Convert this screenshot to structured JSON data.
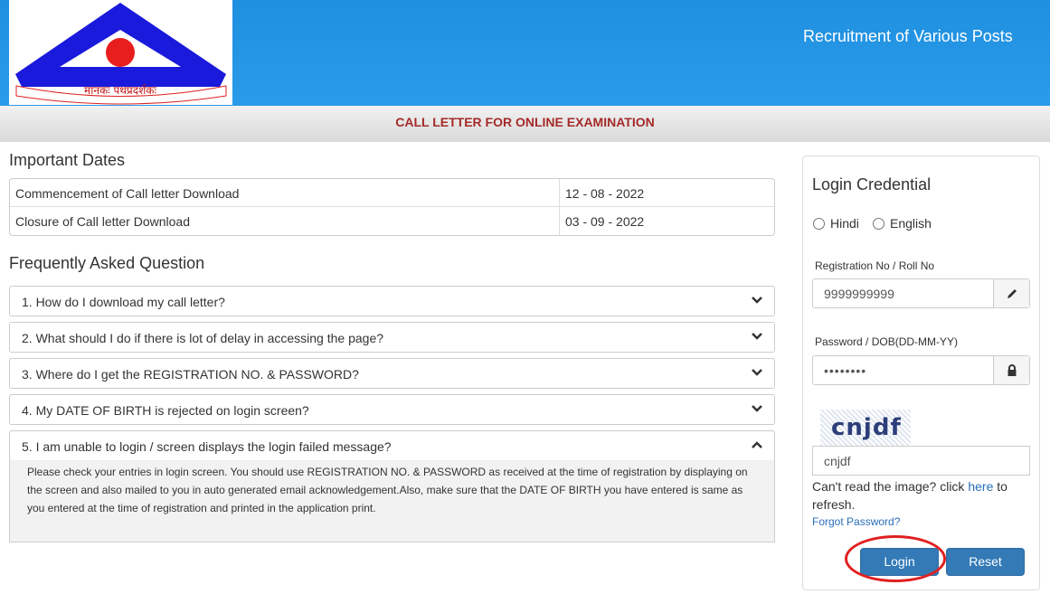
{
  "header": {
    "logo_text": "मानकः पथप्रदर्शकः",
    "title": "Recruitment of Various Posts",
    "subtitle": "CALL LETTER FOR ONLINE EXAMINATION"
  },
  "important_dates": {
    "heading": "Important Dates",
    "rows": [
      {
        "label": "Commencement of Call letter Download",
        "date": "12 - 08 - 2022"
      },
      {
        "label": "Closure of Call letter Download",
        "date": "03 - 09 - 2022"
      }
    ]
  },
  "faq": {
    "heading": "Frequently Asked Question",
    "items": [
      {
        "question": "1. How do I download my call letter?",
        "icon": "chevron-down-icon"
      },
      {
        "question": "2. What should I do if there is lot of delay in accessing the page?",
        "icon": "chevron-down-icon"
      },
      {
        "question": "3. Where do I get the REGISTRATION NO. & PASSWORD?",
        "icon": "chevron-down-icon"
      },
      {
        "question": "4. My DATE OF BIRTH is rejected on login screen?",
        "icon": "chevron-down-icon"
      },
      {
        "question": "5. I am unable to login / screen displays the login failed message?",
        "icon": "chevron-up-icon"
      }
    ],
    "open_answer": "Please check your entries in login screen. You should use REGISTRATION NO. & PASSWORD as received at the time of registration by displaying on the screen and also mailed to you in auto generated email acknowledgement.Also, make sure that the DATE OF BIRTH you have entered is same as you entered at the time of registration and printed in the application print."
  },
  "login": {
    "title": "Login Credential",
    "lang_hindi": "Hindi",
    "lang_english": "English",
    "reg_label": "Registration No / Roll No",
    "reg_value": "9999999999",
    "pwd_label": "Password / DOB(DD-MM-YY)",
    "pwd_value": "••••••••",
    "captcha_image_text": "cnjdf",
    "captcha_value": "cnjdf",
    "help_prefix": "Can't read the image? click ",
    "help_link": "here",
    "help_suffix": " to refresh.",
    "forgot": "Forgot Password?",
    "login_btn": "Login",
    "reset_btn": "Reset"
  },
  "colors": {
    "header_blue": "#2a9be8",
    "subtitle_red": "#a52a2a",
    "button_blue": "#337ab7",
    "highlight_red": "#e02020"
  }
}
